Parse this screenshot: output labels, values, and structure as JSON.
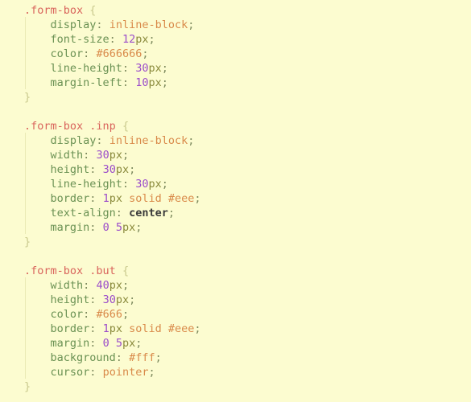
{
  "editor": {
    "language": "css",
    "background_color": "#fcfcd0",
    "indent_guide_color": "#eaeab4"
  },
  "colors": {
    "selector": "#d9645c",
    "brace": "#c9c98d",
    "property": "#6a9153",
    "punctuation": "#7d8a5e",
    "value": "#d98a4a",
    "number": "#9b4dca",
    "unit": "#8a8a3c",
    "keyword_strong": "#3a3a3a"
  },
  "rules": [
    {
      "selector": ".form-box",
      "open_brace": "{",
      "close_brace": "}",
      "declarations": [
        {
          "indent": "    ",
          "property": "display",
          "colon": ":",
          "value": "inline-block",
          "number": "",
          "unit": "",
          "semicolon": ";"
        },
        {
          "indent": "    ",
          "property": "font-size",
          "colon": ":",
          "value": "",
          "number": "12",
          "unit": "px",
          "semicolon": ";"
        },
        {
          "indent": "    ",
          "property": "color",
          "colon": ":",
          "value": "#666666",
          "number": "",
          "unit": "",
          "semicolon": ";"
        },
        {
          "indent": "    ",
          "property": "line-height",
          "colon": ":",
          "value": "",
          "number": "30",
          "unit": "px",
          "semicolon": ";"
        },
        {
          "indent": "    ",
          "property": "margin-left",
          "colon": ":",
          "value": "",
          "number": "10",
          "unit": "px",
          "semicolon": ";"
        }
      ]
    },
    {
      "selector": ".form-box .inp",
      "open_brace": "{",
      "close_brace": "}",
      "declarations": [
        {
          "indent": "    ",
          "property": "display",
          "colon": ":",
          "value": "inline-block",
          "number": "",
          "unit": "",
          "semicolon": ";"
        },
        {
          "indent": "    ",
          "property": "width",
          "colon": ":",
          "value": "",
          "number": "30",
          "unit": "px",
          "semicolon": ";"
        },
        {
          "indent": "    ",
          "property": "height",
          "colon": ":",
          "value": "",
          "number": "30",
          "unit": "px",
          "semicolon": ";"
        },
        {
          "indent": "    ",
          "property": "line-height",
          "colon": ":",
          "value": "",
          "number": "30",
          "unit": "px",
          "semicolon": ";"
        },
        {
          "indent": "    ",
          "property": "border",
          "colon": ":",
          "value": "solid #eee",
          "number": "1",
          "unit": "px",
          "semicolon": ";"
        },
        {
          "indent": "    ",
          "property": "text-align",
          "colon": ":",
          "value": "center",
          "number": "",
          "unit": "",
          "semicolon": ";"
        },
        {
          "indent": "    ",
          "property": "margin",
          "colon": ":",
          "value": "",
          "number": "0 5",
          "unit": "px",
          "semicolon": ";"
        }
      ]
    },
    {
      "selector": ".form-box .but",
      "open_brace": "{",
      "close_brace": "}",
      "declarations": [
        {
          "indent": "    ",
          "property": "width",
          "colon": ":",
          "value": "",
          "number": "40",
          "unit": "px",
          "semicolon": ";"
        },
        {
          "indent": "    ",
          "property": "height",
          "colon": ":",
          "value": "",
          "number": "30",
          "unit": "px",
          "semicolon": ";"
        },
        {
          "indent": "    ",
          "property": "color",
          "colon": ":",
          "value": "#666",
          "number": "",
          "unit": "",
          "semicolon": ";"
        },
        {
          "indent": "    ",
          "property": "border",
          "colon": ":",
          "value": "solid #eee",
          "number": "1",
          "unit": "px",
          "semicolon": ";"
        },
        {
          "indent": "    ",
          "property": "margin",
          "colon": ":",
          "value": "",
          "number": "0 5",
          "unit": "px",
          "semicolon": ";"
        },
        {
          "indent": "    ",
          "property": "background",
          "colon": ":",
          "value": "#fff",
          "number": "",
          "unit": "",
          "semicolon": ";"
        },
        {
          "indent": "    ",
          "property": "cursor",
          "colon": ":",
          "value": "pointer",
          "number": "",
          "unit": "",
          "semicolon": ";"
        }
      ]
    }
  ],
  "lines": [
    {
      "id": "l1",
      "kind": "selector",
      "selector": ".form-box",
      "brace": "{"
    },
    {
      "id": "l2",
      "kind": "decl",
      "property": "display",
      "value_text": "inline-block",
      "value_kind": "value"
    },
    {
      "id": "l3",
      "kind": "decl",
      "property": "font-size",
      "value_text": "12px",
      "value_kind": "numunit",
      "number": "12",
      "unit": "px"
    },
    {
      "id": "l4",
      "kind": "decl",
      "property": "color",
      "value_text": "#666666",
      "value_kind": "value"
    },
    {
      "id": "l5",
      "kind": "decl",
      "property": "line-height",
      "value_text": "30px",
      "value_kind": "numunit",
      "number": "30",
      "unit": "px"
    },
    {
      "id": "l6",
      "kind": "decl",
      "property": "margin-left",
      "value_text": "10px",
      "value_kind": "numunit",
      "number": "10",
      "unit": "px"
    },
    {
      "id": "l7",
      "kind": "close",
      "brace": "}"
    },
    {
      "id": "l8",
      "kind": "blank"
    },
    {
      "id": "l9",
      "kind": "selector",
      "selector": ".form-box .inp",
      "brace": "{"
    },
    {
      "id": "l10",
      "kind": "decl",
      "property": "display",
      "value_text": "inline-block",
      "value_kind": "value"
    },
    {
      "id": "l11",
      "kind": "decl",
      "property": "width",
      "value_text": "30px",
      "value_kind": "numunit",
      "number": "30",
      "unit": "px"
    },
    {
      "id": "l12",
      "kind": "decl",
      "property": "height",
      "value_text": "30px",
      "value_kind": "numunit",
      "number": "30",
      "unit": "px"
    },
    {
      "id": "l13",
      "kind": "decl",
      "property": "line-height",
      "value_text": "30px",
      "value_kind": "numunit",
      "number": "30",
      "unit": "px"
    },
    {
      "id": "l14",
      "kind": "decl",
      "property": "border",
      "value_text": "1px solid #eee",
      "value_kind": "border",
      "number": "1",
      "unit": "px",
      "rest": "solid #eee"
    },
    {
      "id": "l15",
      "kind": "decl",
      "property": "text-align",
      "value_text": "center",
      "value_kind": "strong"
    },
    {
      "id": "l16",
      "kind": "decl",
      "property": "margin",
      "value_text": "0 5px",
      "value_kind": "margin",
      "n1": "0",
      "n2": "5",
      "unit": "px"
    },
    {
      "id": "l17",
      "kind": "close",
      "brace": "}"
    },
    {
      "id": "l18",
      "kind": "blank"
    },
    {
      "id": "l19",
      "kind": "selector",
      "selector": ".form-box .but",
      "brace": "{"
    },
    {
      "id": "l20",
      "kind": "decl",
      "property": "width",
      "value_text": "40px",
      "value_kind": "numunit",
      "number": "40",
      "unit": "px"
    },
    {
      "id": "l21",
      "kind": "decl",
      "property": "height",
      "value_text": "30px",
      "value_kind": "numunit",
      "number": "30",
      "unit": "px"
    },
    {
      "id": "l22",
      "kind": "decl",
      "property": "color",
      "value_text": "#666",
      "value_kind": "value"
    },
    {
      "id": "l23",
      "kind": "decl",
      "property": "border",
      "value_text": "1px solid #eee",
      "value_kind": "border",
      "number": "1",
      "unit": "px",
      "rest": "solid #eee"
    },
    {
      "id": "l24",
      "kind": "decl",
      "property": "margin",
      "value_text": "0 5px",
      "value_kind": "margin",
      "n1": "0",
      "n2": "5",
      "unit": "px"
    },
    {
      "id": "l25",
      "kind": "decl",
      "property": "background",
      "value_text": "#fff",
      "value_kind": "value"
    },
    {
      "id": "l26",
      "kind": "decl",
      "property": "cursor",
      "value_text": "pointer",
      "value_kind": "value"
    },
    {
      "id": "l27",
      "kind": "close",
      "brace": "}"
    }
  ],
  "symbols": {
    "colon": ":",
    "semicolon": ";",
    "open_brace": "{",
    "close_brace": "}",
    "indent": "    ",
    "space": " "
  }
}
